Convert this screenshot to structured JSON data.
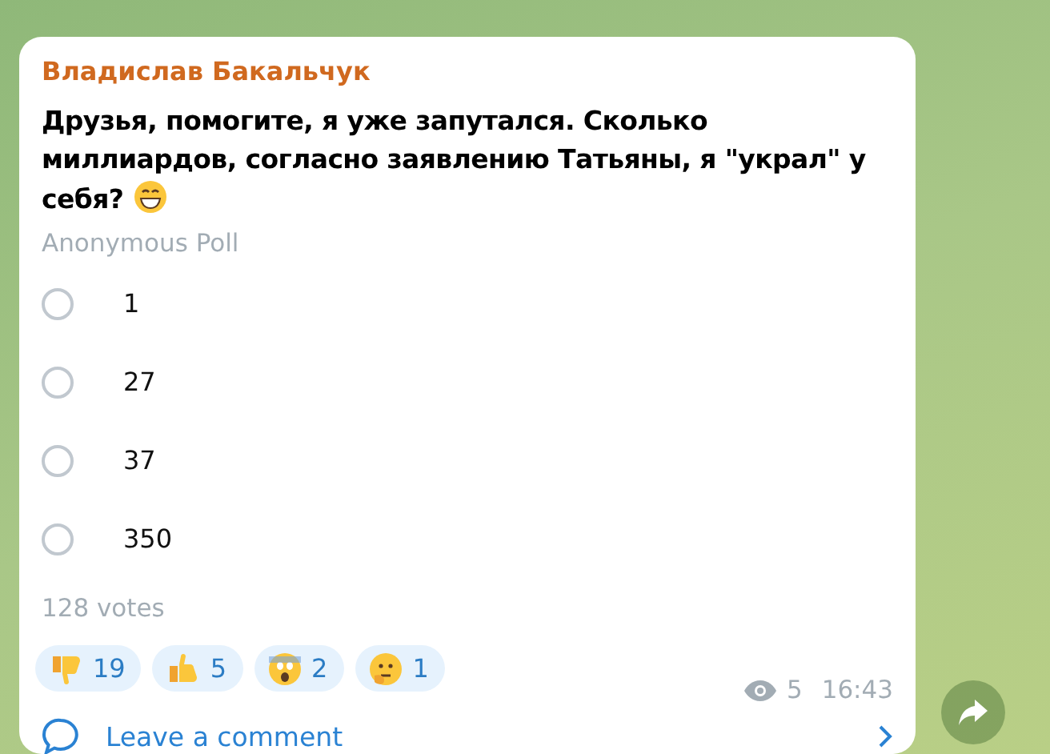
{
  "message": {
    "author": "Владислав Бакальчук",
    "text": "Друзья, помогите, я уже запутался. Сколько миллиардов, согласно заявлению Татьяны, я \"украл\" у себя?",
    "poll_type": "Anonymous Poll",
    "options": [
      {
        "label": "1",
        "selected": false
      },
      {
        "label": "27",
        "selected": false
      },
      {
        "label": "37",
        "selected": false
      },
      {
        "label": "350",
        "selected": false
      }
    ],
    "votes": "128 votes",
    "reactions": [
      {
        "kind": "thumbs-down",
        "count": "19"
      },
      {
        "kind": "thumbs-up",
        "count": "5"
      },
      {
        "kind": "scream",
        "count": "2"
      },
      {
        "kind": "thinking",
        "count": "1"
      }
    ],
    "views": "5",
    "time": "16:43",
    "comment_link": "Leave a comment"
  }
}
